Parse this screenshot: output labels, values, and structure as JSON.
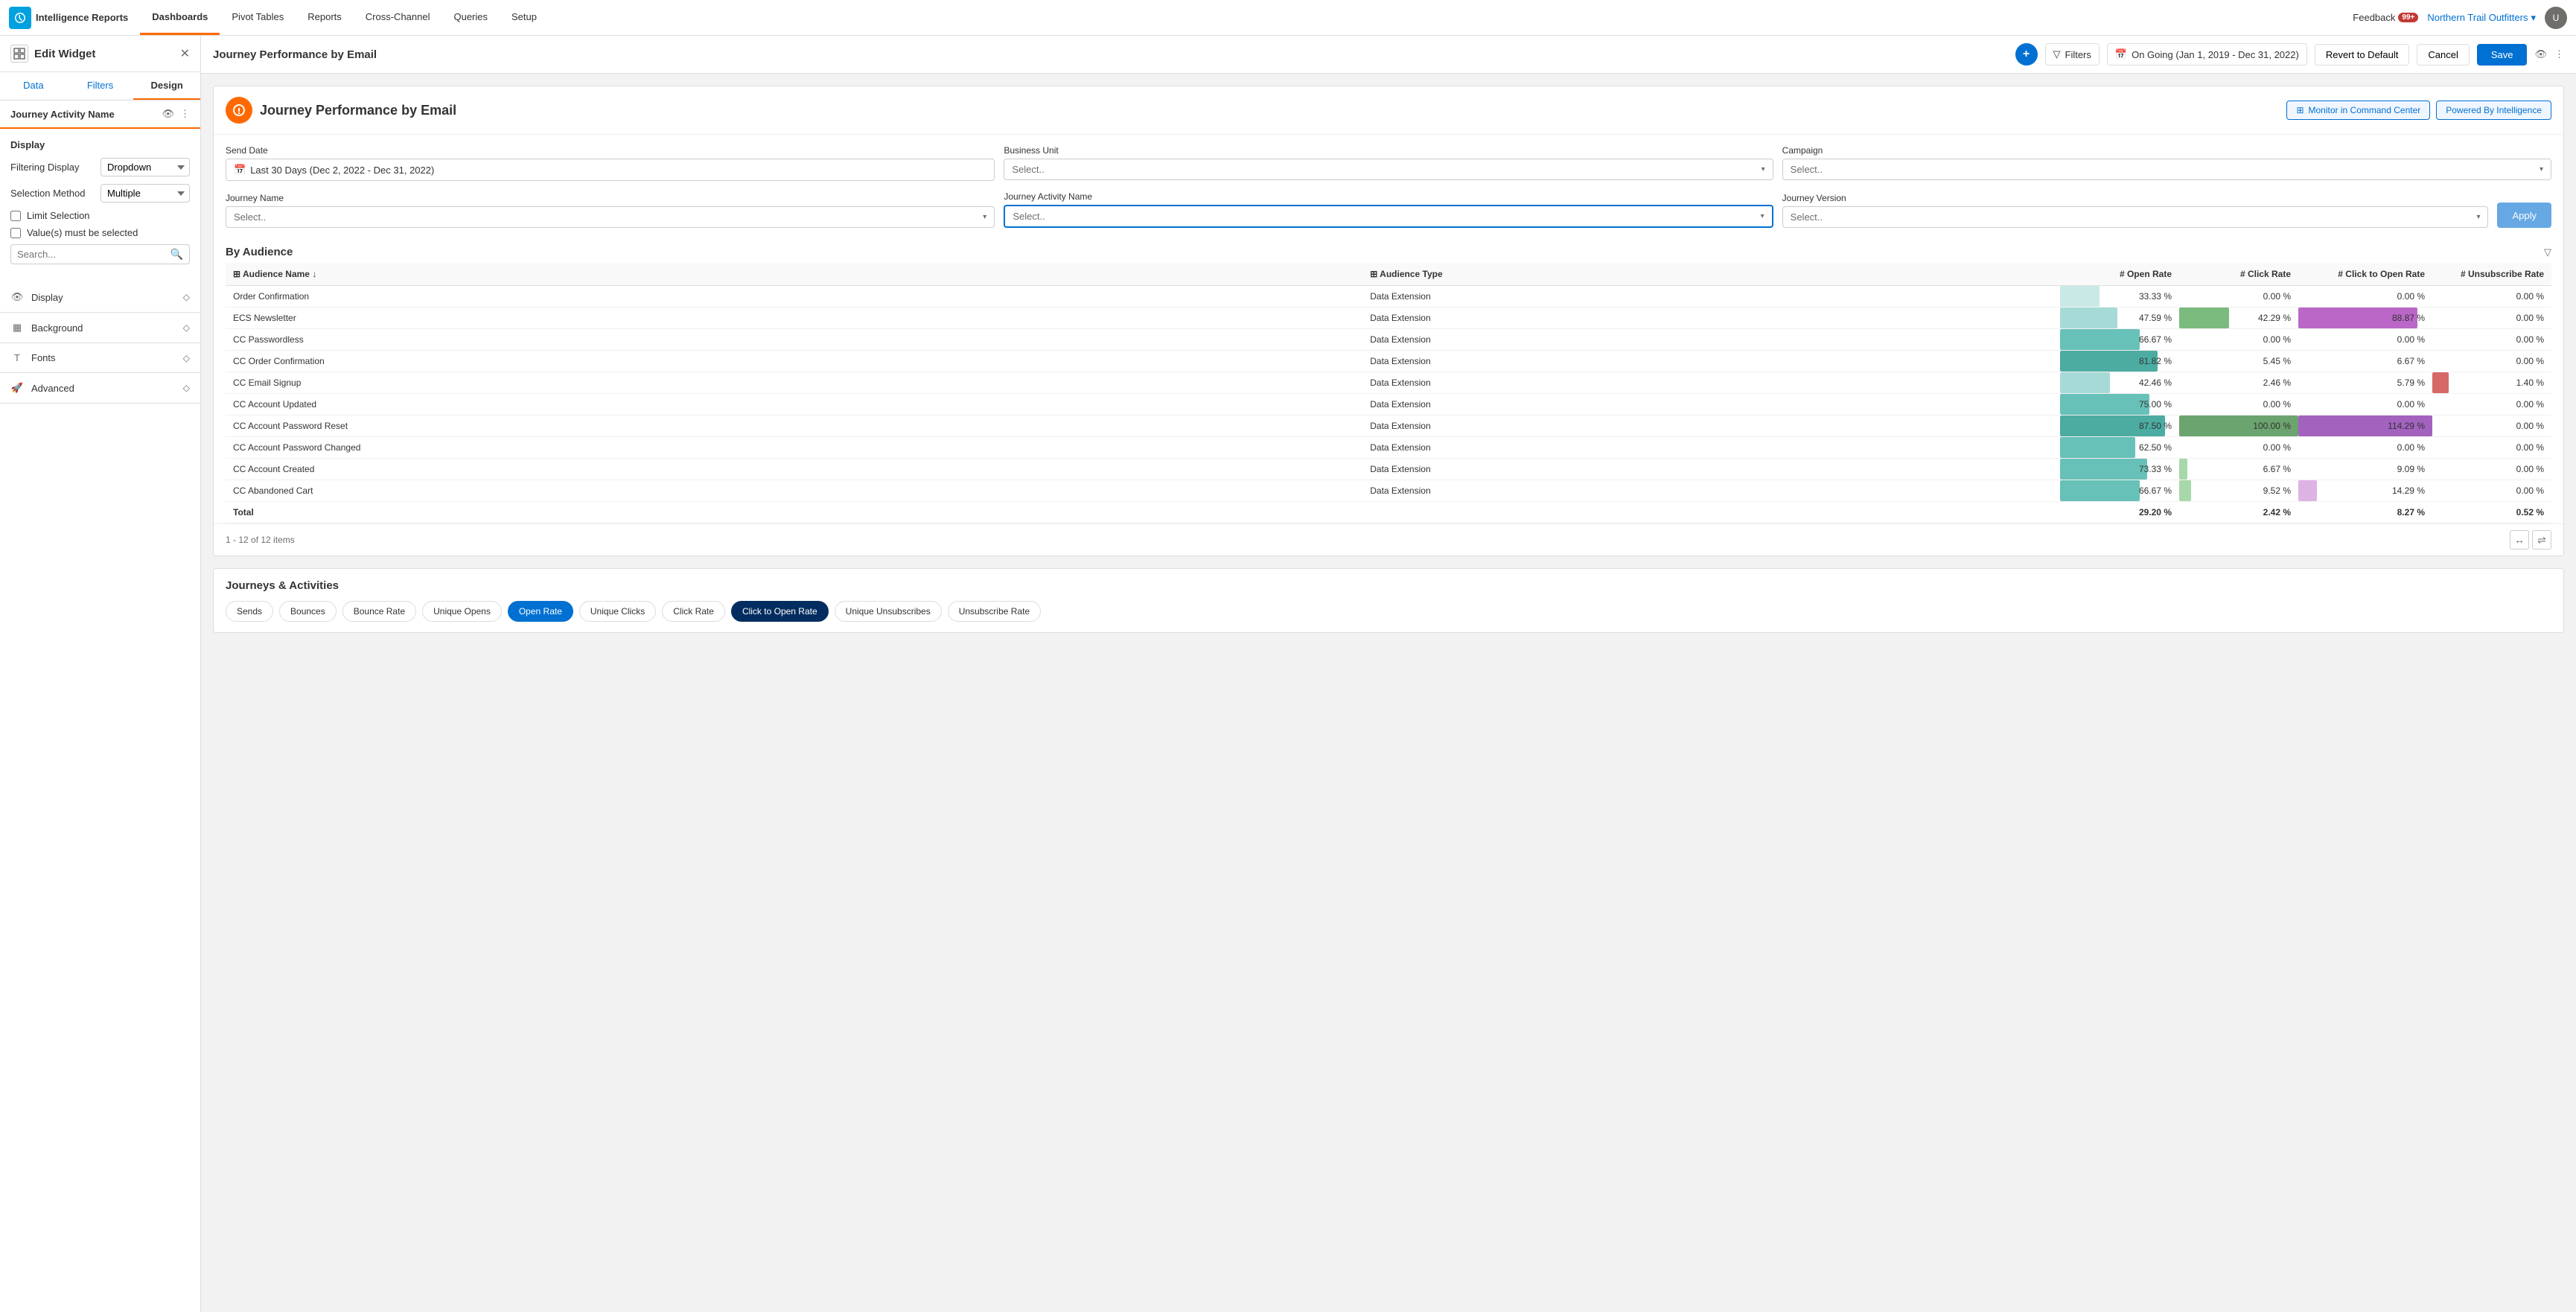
{
  "app": {
    "logo_text": "Intelligence Reports"
  },
  "top_nav": {
    "tabs": [
      {
        "label": "Dashboards",
        "active": true
      },
      {
        "label": "Pivot Tables",
        "active": false
      },
      {
        "label": "Reports",
        "active": false
      },
      {
        "label": "Cross-Channel",
        "active": false
      },
      {
        "label": "Queries",
        "active": false
      },
      {
        "label": "Setup",
        "active": false
      }
    ],
    "feedback": "Feedback",
    "notif_count": "99+",
    "org_name": "Northern Trail Outfitters",
    "avatar_initials": "U"
  },
  "sidebar": {
    "title": "Edit Widget",
    "tabs": [
      "Data",
      "Filters",
      "Design"
    ],
    "active_tab": "Design",
    "widget_name": "Journey Activity Name",
    "display_section": {
      "title": "Display",
      "filtering_display_label": "Filtering Display",
      "filtering_display_value": "Dropdown",
      "selection_method_label": "Selection Method",
      "selection_method_value": "Multiple",
      "limit_selection": "Limit Selection",
      "values_must_be_selected": "Value(s) must be selected",
      "search_placeholder": "Search..."
    },
    "accordion_items": [
      {
        "label": "Display",
        "icon": "eye"
      },
      {
        "label": "Background",
        "icon": "background"
      },
      {
        "label": "Fonts",
        "icon": "font"
      },
      {
        "label": "Advanced",
        "icon": "advanced"
      }
    ]
  },
  "toolbar": {
    "title": "Journey Performance by Email",
    "filters_label": "Filters",
    "date_range": "On Going (Jan 1, 2019 - Dec 31, 2022)",
    "revert_label": "Revert to Default",
    "cancel_label": "Cancel",
    "save_label": "Save"
  },
  "report": {
    "title": "Journey Performance by Email",
    "monitor_btn": "Monitor in Command Center",
    "powered_btn": "Powered By Intelligence",
    "filters": {
      "send_date_label": "Send Date",
      "send_date_value": "Last 30 Days (Dec 2, 2022 - Dec 31, 2022)",
      "business_unit_label": "Business Unit",
      "business_unit_placeholder": "Select..",
      "campaign_label": "Campaign",
      "campaign_placeholder": "Select..",
      "journey_name_label": "Journey Name",
      "journey_name_placeholder": "Select..",
      "journey_activity_label": "Journey Activity Name",
      "journey_activity_placeholder": "Select..",
      "journey_version_label": "Journey Version",
      "journey_version_placeholder": "Select..",
      "apply_label": "Apply"
    },
    "by_audience": {
      "title": "By Audience",
      "columns": [
        "Audience Name",
        "Audience Type",
        "Open Rate",
        "Click Rate",
        "Click to Open Rate",
        "Unsubscribe Rate"
      ],
      "rows": [
        {
          "name": "Order Confirmation",
          "type": "Data Extension",
          "open_rate": "33.33 %",
          "click_rate": "0.00 %",
          "ctor": "0.00 %",
          "unsub": "0.00 %",
          "open_pct": 33,
          "click_pct": 0,
          "ctor_pct": 0,
          "unsub_pct": 0
        },
        {
          "name": "ECS Newsletter",
          "type": "Data Extension",
          "open_rate": "47.59 %",
          "click_rate": "42.29 %",
          "ctor": "88.87 %",
          "unsub": "0.00 %",
          "open_pct": 48,
          "click_pct": 42,
          "ctor_pct": 89,
          "unsub_pct": 0
        },
        {
          "name": "CC Passwordless",
          "type": "Data Extension",
          "open_rate": "66.67 %",
          "click_rate": "0.00 %",
          "ctor": "0.00 %",
          "unsub": "0.00 %",
          "open_pct": 67,
          "click_pct": 0,
          "ctor_pct": 0,
          "unsub_pct": 0
        },
        {
          "name": "CC Order Confirmation",
          "type": "Data Extension",
          "open_rate": "81.82 %",
          "click_rate": "5.45 %",
          "ctor": "6.67 %",
          "unsub": "0.00 %",
          "open_pct": 82,
          "click_pct": 5,
          "ctor_pct": 7,
          "unsub_pct": 0
        },
        {
          "name": "CC Email Signup",
          "type": "Data Extension",
          "open_rate": "42.46 %",
          "click_rate": "2.46 %",
          "ctor": "5.79 %",
          "unsub": "1.40 %",
          "open_pct": 42,
          "click_pct": 2,
          "ctor_pct": 6,
          "unsub_pct": 14
        },
        {
          "name": "CC Account Updated",
          "type": "Data Extension",
          "open_rate": "75.00 %",
          "click_rate": "0.00 %",
          "ctor": "0.00 %",
          "unsub": "0.00 %",
          "open_pct": 75,
          "click_pct": 0,
          "ctor_pct": 0,
          "unsub_pct": 0
        },
        {
          "name": "CC Account Password Reset",
          "type": "Data Extension",
          "open_rate": "87.50 %",
          "click_rate": "100.00 %",
          "ctor": "114.29 %",
          "unsub": "0.00 %",
          "open_pct": 88,
          "click_pct": 100,
          "ctor_pct": 100,
          "unsub_pct": 0
        },
        {
          "name": "CC Account Password Changed",
          "type": "Data Extension",
          "open_rate": "62.50 %",
          "click_rate": "0.00 %",
          "ctor": "0.00 %",
          "unsub": "0.00 %",
          "open_pct": 63,
          "click_pct": 0,
          "ctor_pct": 0,
          "unsub_pct": 0
        },
        {
          "name": "CC Account Created",
          "type": "Data Extension",
          "open_rate": "73.33 %",
          "click_rate": "6.67 %",
          "ctor": "9.09 %",
          "unsub": "0.00 %",
          "open_pct": 73,
          "click_pct": 7,
          "ctor_pct": 9,
          "unsub_pct": 0
        },
        {
          "name": "CC Abandoned Cart",
          "type": "Data Extension",
          "open_rate": "66.67 %",
          "click_rate": "9.52 %",
          "ctor": "14.29 %",
          "unsub": "0.00 %",
          "open_pct": 67,
          "click_pct": 10,
          "ctor_pct": 14,
          "unsub_pct": 0
        }
      ],
      "total_row": {
        "label": "Total",
        "open_rate": "29.20 %",
        "click_rate": "2.42 %",
        "ctor": "8.27 %",
        "unsub": "0.52 %"
      },
      "pagination": "1 - 12 of 12 items"
    },
    "journeys_section": {
      "title": "Journeys & Activities",
      "pill_tabs": [
        {
          "label": "Sends",
          "active": false
        },
        {
          "label": "Bounces",
          "active": false
        },
        {
          "label": "Bounce Rate",
          "active": false
        },
        {
          "label": "Unique Opens",
          "active": false
        },
        {
          "label": "Open Rate",
          "active": true
        },
        {
          "label": "Unique Clicks",
          "active": false
        },
        {
          "label": "Click Rate",
          "active": false
        },
        {
          "label": "Click to Open Rate",
          "active": true,
          "style": "dark"
        },
        {
          "label": "Unique Unsubscribes",
          "active": false
        },
        {
          "label": "Unsubscribe Rate",
          "active": false
        }
      ]
    }
  }
}
